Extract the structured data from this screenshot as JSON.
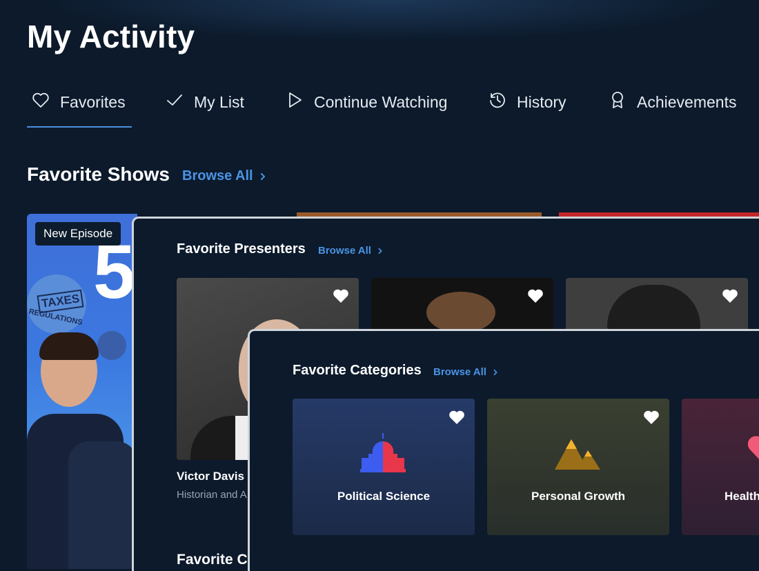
{
  "page": {
    "title": "My Activity"
  },
  "tabs": [
    {
      "label": "Favorites",
      "icon": "heart-icon",
      "active": true
    },
    {
      "label": "My List",
      "icon": "check-icon"
    },
    {
      "label": "Continue Watching",
      "icon": "play-icon"
    },
    {
      "label": "History",
      "icon": "history-icon"
    },
    {
      "label": "Achievements",
      "icon": "award-icon"
    }
  ],
  "favorite_shows": {
    "title": "Favorite Shows",
    "browse_label": "Browse All",
    "card": {
      "badge": "New Episode",
      "big_text": "5",
      "sticker_main": "TAXES",
      "sticker_sub": "REGULATIONS"
    }
  },
  "favorite_presenters": {
    "title": "Favorite Presenters",
    "browse_label": "Browse All",
    "first_name": "Victor Davis H",
    "first_role": "Historian and A"
  },
  "favorite_categories": {
    "title": "Favorite Categories",
    "browse_label": "Browse All",
    "items": [
      {
        "label": "Political Science",
        "icon": "capitol-icon"
      },
      {
        "label": "Personal Growth",
        "icon": "mountain-icon"
      },
      {
        "label": "Health",
        "icon": "heart-icon"
      }
    ]
  },
  "next_section_partial": "Favorite Ca",
  "colors": {
    "accent": "#4a94e6",
    "background": "#0c1a2b",
    "panel_border": "#cfd5dc"
  }
}
